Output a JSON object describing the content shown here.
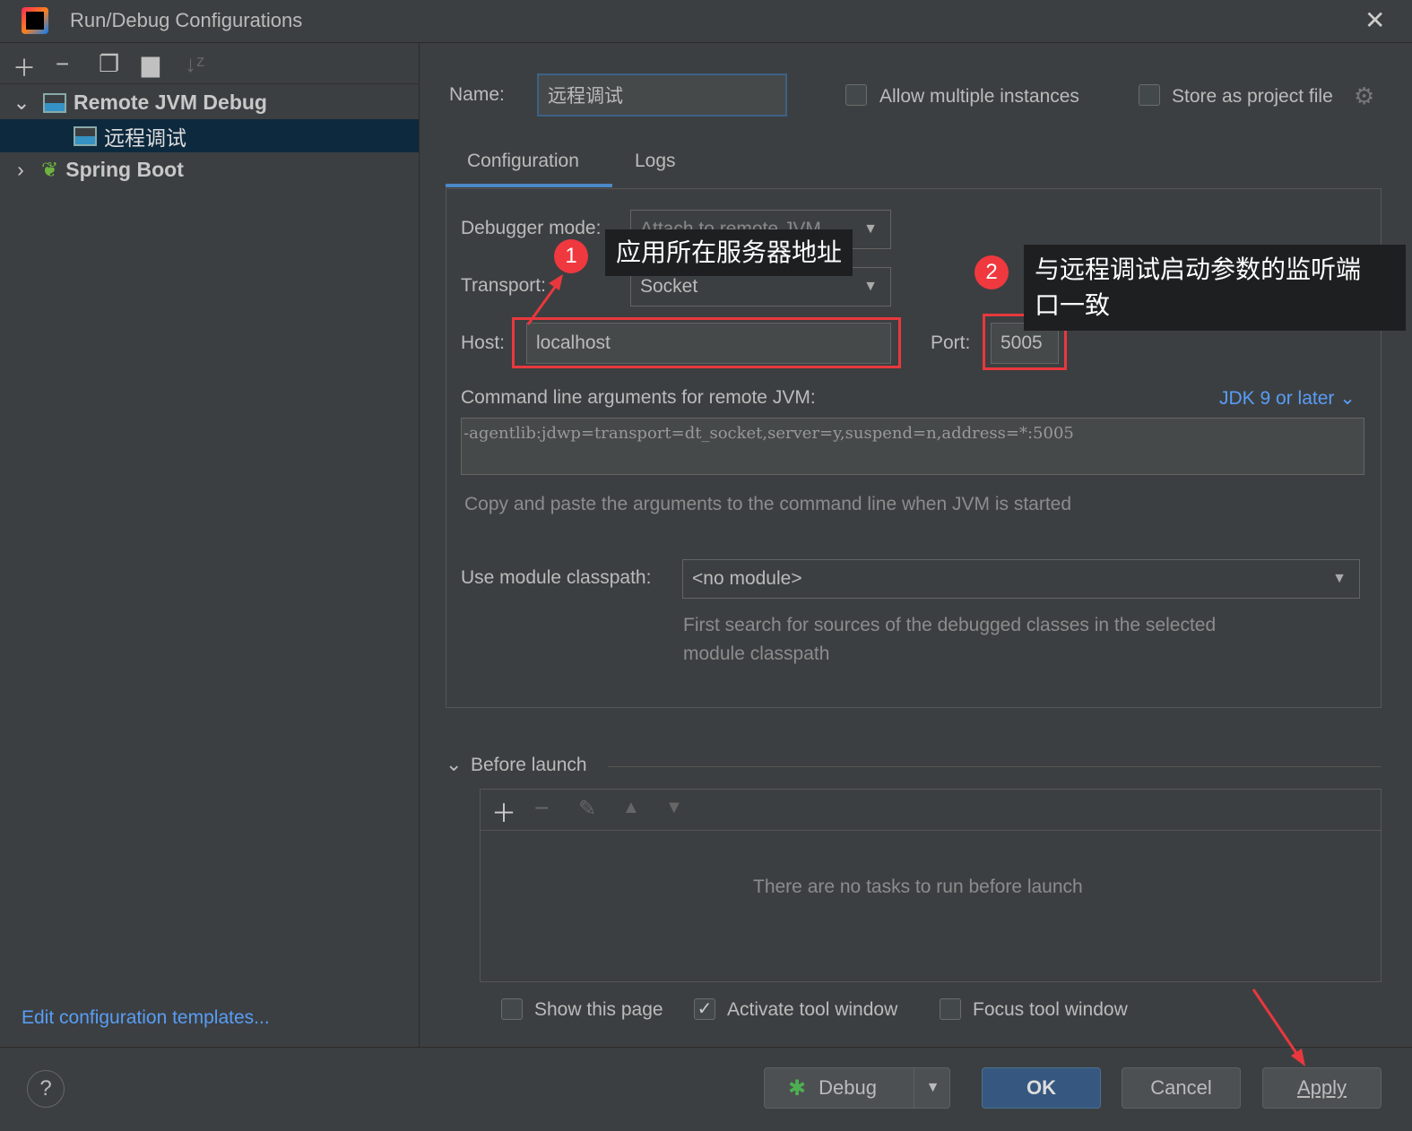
{
  "window": {
    "title": "Run/Debug Configurations"
  },
  "sidebar": {
    "items": [
      {
        "label": "Remote JVM Debug"
      },
      {
        "label": "远程调试"
      },
      {
        "label": "Spring Boot"
      }
    ],
    "edit_templates": "Edit configuration templates..."
  },
  "header": {
    "name_label": "Name:",
    "name_value": "远程调试",
    "allow_multiple": "Allow multiple instances",
    "allow_multiple_checked": false,
    "store_project": "Store as project file",
    "store_project_checked": false
  },
  "tabs": [
    {
      "label": "Configuration",
      "active": true
    },
    {
      "label": "Logs",
      "active": false
    }
  ],
  "config": {
    "debugger_mode_label": "Debugger mode:",
    "debugger_mode": "Attach to remote JVM",
    "transport_label": "Transport:",
    "transport": "Socket",
    "host_label": "Host:",
    "host": "localhost",
    "port_label": "Port:",
    "port": "5005",
    "cmd_label": "Command line arguments for remote JVM:",
    "jdk": "JDK 9 or later",
    "cmd_value": "-agentlib:jdwp=transport=dt_socket,server=y,suspend=n,address=*:5005",
    "cmd_hint": "Copy and paste the arguments to the command line when JVM is started",
    "module_label": "Use module classpath:",
    "module": "<no module>",
    "module_hint1": "First search for sources of the debugged classes in the selected",
    "module_hint2": "module classpath"
  },
  "before_launch": {
    "title": "Before launch",
    "empty": "There are no tasks to run before launch",
    "show_page": "Show this page",
    "show_page_checked": false,
    "activate": "Activate tool window",
    "activate_checked": true,
    "focus": "Focus tool window",
    "focus_checked": false
  },
  "annotations": {
    "one": "1",
    "one_text": "应用所在服务器地址",
    "two": "2",
    "two_text1": "与远程调试启动参数的监听端",
    "two_text2": "口一致",
    "color": "#e8383d"
  },
  "footer": {
    "debug": "Debug",
    "ok": "OK",
    "cancel": "Cancel",
    "apply": "Apply",
    "help": "?"
  }
}
